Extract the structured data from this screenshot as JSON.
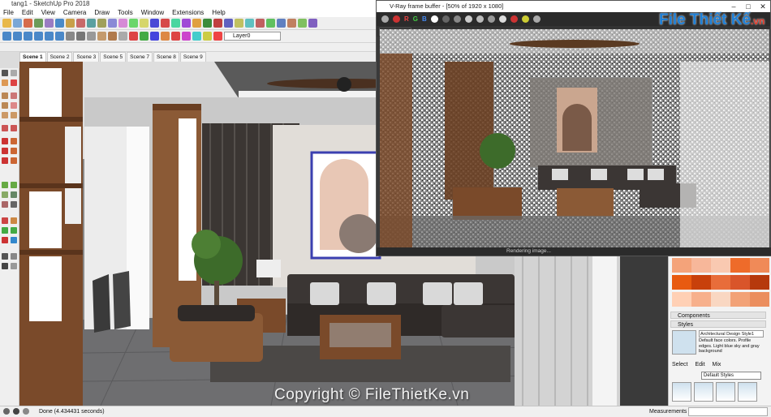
{
  "sketchup": {
    "title": "tang1 - SketchUp Pro 2018",
    "menu": [
      "File",
      "Edit",
      "View",
      "Camera",
      "Draw",
      "Tools",
      "Window",
      "Extensions",
      "Help"
    ],
    "layer_value": "Layer0",
    "scenes": [
      "Scene 1",
      "Scene 2",
      "Scene 3",
      "Scene 5",
      "Scene 7",
      "Scene 8",
      "Scene 9"
    ],
    "status_text": "Done (4.434431 seconds)",
    "measurements_label": "Measurements"
  },
  "vray": {
    "title": "V-Ray frame buffer - [50% of 1920 x 1080]",
    "channel": "RGB color",
    "status": "Rendering image...",
    "toolbar_letters": [
      "R",
      "G",
      "B"
    ]
  },
  "tray": {
    "components_label": "Components",
    "styles_label": "Styles",
    "style_name": "Architectural Design Style1",
    "style_desc": "Default face colors. Profile edges. Light blue sky and gray background",
    "tabs": [
      "Select",
      "Edit",
      "Mix"
    ],
    "style_collection": "Default Styles",
    "swatch_colors": [
      "#f4a37a",
      "#f7b79a",
      "#f9c9b1",
      "#ee6b2a",
      "#f08a58",
      "#e85a10",
      "#c8400b",
      "#e86d3a",
      "#d9552a",
      "#b6390c",
      "#ffd0b5",
      "#f7b08c",
      "#f9d7c2",
      "#f2a277",
      "#eb8e5e"
    ]
  },
  "overlay": {
    "watermark": "Copyright © FileThietKe.vn",
    "logo_main": "File Thiết Kế",
    "logo_tld": ".vn"
  },
  "colors": {
    "accent": "#1e7fd6",
    "wood": "#7a4a2a",
    "sofa": "#3b3634"
  }
}
